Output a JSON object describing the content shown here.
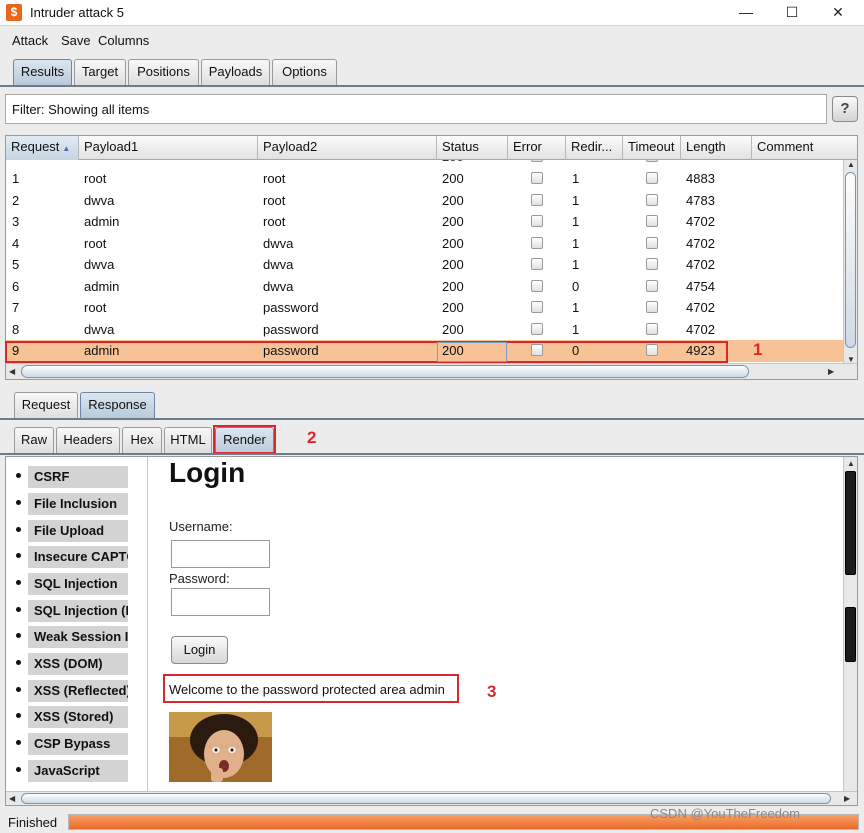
{
  "window": {
    "title": "Intruder attack 5",
    "minimize": "—",
    "maximize": "☐",
    "close": "✕"
  },
  "menu": [
    "Attack",
    "Save",
    "Columns"
  ],
  "tabs": [
    "Results",
    "Target",
    "Positions",
    "Payloads",
    "Options"
  ],
  "filter": {
    "text": "Filter: Showing all items",
    "help": "?"
  },
  "table": {
    "columns": [
      "Request",
      "Payload1",
      "Payload2",
      "Status",
      "Error",
      "Redir...",
      "Timeout",
      "Length",
      "Comment"
    ],
    "rows": [
      {
        "request": "1",
        "payload1": "root",
        "payload2": "root",
        "status": "200",
        "redir": "1",
        "length": "4883"
      },
      {
        "request": "2",
        "payload1": "dwva",
        "payload2": "root",
        "status": "200",
        "redir": "1",
        "length": "4783"
      },
      {
        "request": "3",
        "payload1": "admin",
        "payload2": "root",
        "status": "200",
        "redir": "1",
        "length": "4702"
      },
      {
        "request": "4",
        "payload1": "root",
        "payload2": "dwva",
        "status": "200",
        "redir": "1",
        "length": "4702"
      },
      {
        "request": "5",
        "payload1": "dwva",
        "payload2": "dwva",
        "status": "200",
        "redir": "1",
        "length": "4702"
      },
      {
        "request": "6",
        "payload1": "admin",
        "payload2": "dwva",
        "status": "200",
        "redir": "0",
        "length": "4754"
      },
      {
        "request": "7",
        "payload1": "root",
        "payload2": "password",
        "status": "200",
        "redir": "1",
        "length": "4702"
      },
      {
        "request": "8",
        "payload1": "dwva",
        "payload2": "password",
        "status": "200",
        "redir": "1",
        "length": "4702"
      },
      {
        "request": "9",
        "payload1": "admin",
        "payload2": "password",
        "status": "200",
        "redir": "0",
        "length": "4923"
      }
    ],
    "selected_row": "9"
  },
  "reqresp_tabs": [
    "Request",
    "Response"
  ],
  "view_tabs": [
    "Raw",
    "Headers",
    "Hex",
    "HTML",
    "Render"
  ],
  "annotations": [
    "1",
    "2",
    "3"
  ],
  "render": {
    "sidebar": [
      "CSRF",
      "File Inclusion",
      "File Upload",
      "Insecure CAPTCHA",
      "SQL Injection",
      "SQL Injection (Blind)",
      "Weak Session IDs",
      "XSS (DOM)",
      "XSS (Reflected)",
      "XSS (Stored)",
      "CSP Bypass",
      "JavaScript"
    ],
    "heading": "Login",
    "username_label": "Username:",
    "password_label": "Password:",
    "login_button": "Login",
    "welcome": "Welcome to the password protected area admin"
  },
  "status": {
    "text": "Finished",
    "progress": 1.0
  },
  "watermark": "CSDN @YouTheFreedom",
  "colors": {
    "selected_row": "#f7c295",
    "annotation": "#d9272e",
    "progress": "#ea6a2a",
    "active_tab": "#b8cad9"
  }
}
